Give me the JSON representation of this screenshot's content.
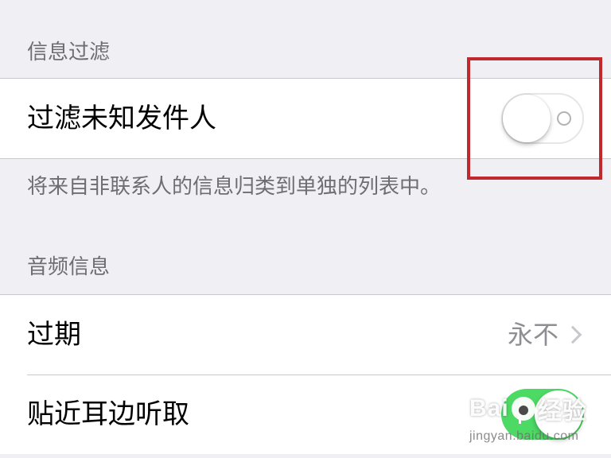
{
  "sections": {
    "message_filtering": {
      "header": "信息过滤",
      "row_label": "过滤未知发件人",
      "toggle_state": "off",
      "footer": "将来自非联系人的信息归类到单独的列表中。"
    },
    "audio_messages": {
      "header": "音频信息",
      "expire": {
        "label": "过期",
        "value": "永不"
      },
      "raise_to_listen": {
        "label": "贴近耳边听取",
        "toggle_state": "on"
      }
    }
  },
  "colors": {
    "background": "#efeff4",
    "toggle_on": "#4cd964",
    "highlight": "#c0282d"
  },
  "watermark": {
    "brand_left": "Bai",
    "brand_right": "经验",
    "url": "jingyan.baidu.com"
  }
}
